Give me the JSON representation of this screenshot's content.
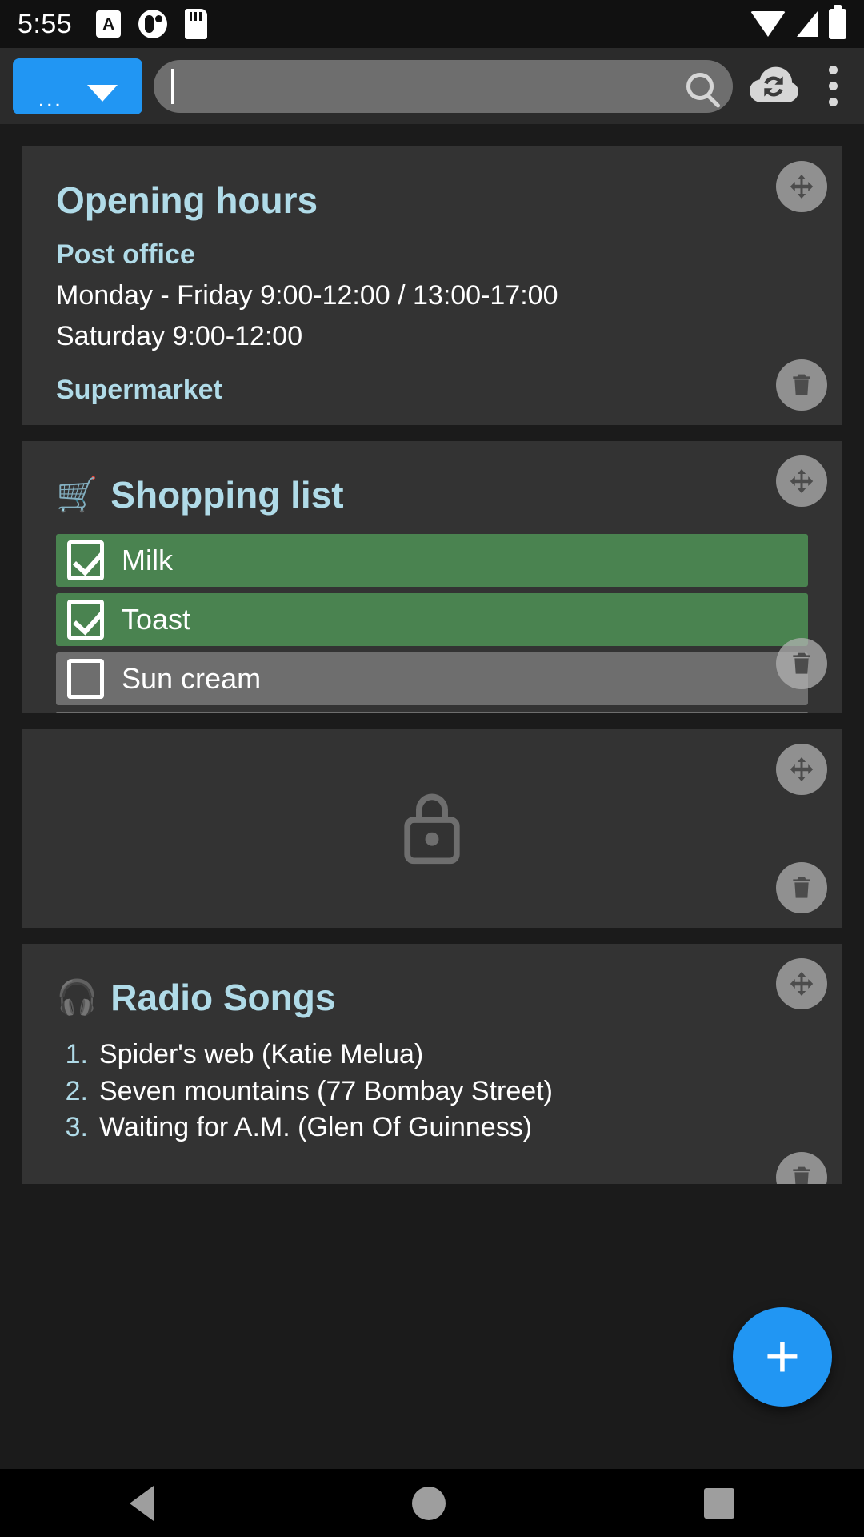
{
  "statusbar": {
    "time": "5:55",
    "icons_left": [
      "a-box-icon",
      "circle-avatar-icon",
      "sd-card-icon"
    ],
    "icons_right": [
      "wifi-icon",
      "cellular-signal-icon",
      "battery-icon"
    ]
  },
  "toolbar": {
    "filter_label": "...",
    "filter_caret": "chevron-down-icon",
    "search_value": "",
    "search_placeholder": "",
    "search_icon": "search-icon",
    "sync_icon": "cloud-sync-icon",
    "overflow_icon": "more-vertical-icon"
  },
  "notes": [
    {
      "id": "opening-hours",
      "title": "Opening hours",
      "emoji": "",
      "kind": "text",
      "subheading": "Post office",
      "lines": [
        "Monday - Friday 9:00-12:00 / 13:00-17:00",
        "Saturday 9:00-12:00"
      ],
      "subheading2": "Supermarket",
      "move_icon": "move-handle-icon",
      "delete_icon": "trash-icon"
    },
    {
      "id": "shopping-list",
      "title": "Shopping list",
      "emoji": "🛒",
      "kind": "checklist",
      "items": [
        {
          "label": "Milk",
          "checked": true
        },
        {
          "label": "Toast",
          "checked": true
        },
        {
          "label": "Sun cream",
          "checked": false
        },
        {
          "label": "",
          "checked": false
        }
      ],
      "move_icon": "move-handle-icon",
      "delete_icon": "trash-icon"
    },
    {
      "id": "locked-note",
      "title": "",
      "kind": "locked",
      "lock_icon": "lock-icon",
      "move_icon": "move-handle-icon",
      "delete_icon": "trash-icon"
    },
    {
      "id": "radio-songs",
      "title": "Radio Songs",
      "emoji": "🎧",
      "kind": "ordered-list",
      "items": [
        {
          "num": "1.",
          "label": "Spider's web (Katie Melua)"
        },
        {
          "num": "2.",
          "label": "Seven mountains (77 Bombay Street)"
        },
        {
          "num": "3.",
          "label": "Waiting for A.M. (Glen Of Guinness)"
        }
      ],
      "move_icon": "move-handle-icon",
      "delete_icon": "trash-icon"
    }
  ],
  "fab": {
    "label": "+",
    "icon": "plus-icon"
  },
  "navbar": {
    "back": "back-triangle-icon",
    "home": "home-circle-icon",
    "recents": "recents-square-icon"
  },
  "colors": {
    "accent_blue": "#2196f3",
    "title_blue": "#b0dbe8",
    "card_bg": "#333333",
    "page_bg": "#1b1b1b",
    "checked_green": "#4a8350",
    "unchecked_grey": "#6e6e6e"
  }
}
